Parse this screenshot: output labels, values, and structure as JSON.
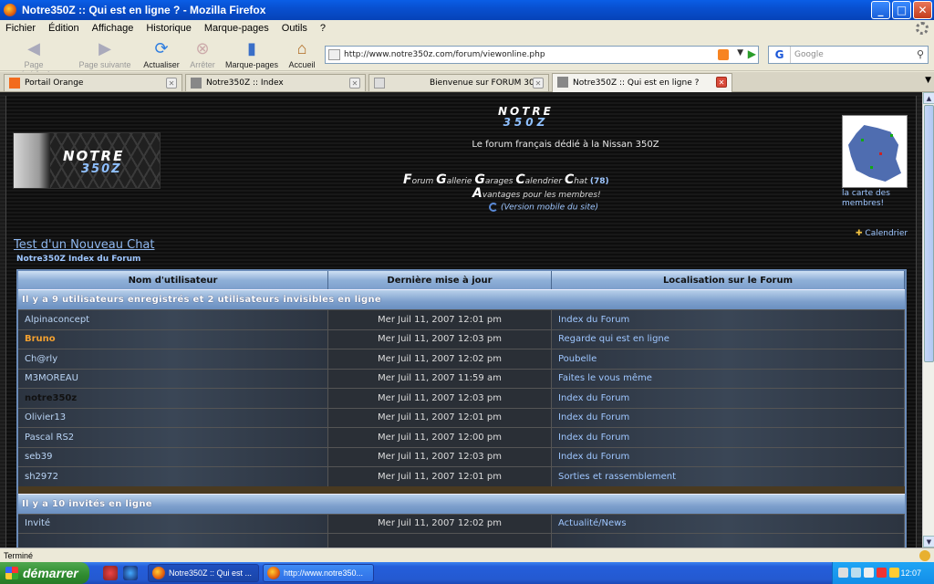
{
  "window": {
    "title": "Notre350Z :: Qui est en ligne ? - Mozilla Firefox",
    "buttons": [
      "_",
      "□",
      "✕"
    ]
  },
  "menu": [
    "Fichier",
    "Édition",
    "Affichage",
    "Historique",
    "Marque-pages",
    "Outils",
    "?"
  ],
  "toolbar": {
    "back": "Page précédente",
    "forward": "Page suivante",
    "reload": "Actualiser",
    "stop": "Arrêter",
    "bookmarks": "Marque-pages",
    "home": "Accueil",
    "url": "http://www.notre350z.com/forum/viewonline.php",
    "search_placeholder": "Google",
    "search_engine_icon": "G"
  },
  "tabs": [
    {
      "label": "Portail Orange",
      "icon_color": "#f26b1d"
    },
    {
      "label": "Notre350Z :: Index",
      "icon_color": "#888888"
    },
    {
      "label": "Bienvenue sur FORUM 30...",
      "icon_color": "#dddddd"
    },
    {
      "label": "Notre350Z :: Qui est en ligne ?",
      "icon_color": "#888888",
      "active": true
    }
  ],
  "page": {
    "logo_line1": "NOTRE",
    "logo_line2": "350Z",
    "tagline": "Le forum français dédié à la Nissan 350Z",
    "nav": {
      "forum": "orum",
      "galerie": "allerie",
      "garages": "arages",
      "calendrier": "alendrier",
      "chat": "hat",
      "chat_count": "(78)",
      "avantages": "vantages pour les membres!",
      "mobile": "(Version mobile du site)"
    },
    "map_caption": "la carte des membres!",
    "calendar_link": "Calendrier",
    "chat_title": "Test d'un Nouveau Chat",
    "breadcrumb": "Notre350Z Index du Forum",
    "table": {
      "headers": [
        "Nom d'utilisateur",
        "Dernière mise à jour",
        "Localisation sur le Forum"
      ],
      "registered_heading": "Il y a 9 utilisateurs enregistrés et 2 utilisateurs invisibles en ligne",
      "registered": [
        {
          "user": "Alpinaconcept",
          "time": "Mer Juil 11, 2007 12:01 pm",
          "location": "Index du Forum",
          "style": "normal"
        },
        {
          "user": "Bruno",
          "time": "Mer Juil 11, 2007 12:03 pm",
          "location": "Regarde qui est en ligne",
          "style": "orange"
        },
        {
          "user": "Ch@rly",
          "time": "Mer Juil 11, 2007 12:02 pm",
          "location": "Poubelle",
          "style": "normal"
        },
        {
          "user": "M3MOREAU",
          "time": "Mer Juil 11, 2007 11:59 am",
          "location": "Faites le vous même",
          "style": "normal"
        },
        {
          "user": "notre350z",
          "time": "Mer Juil 11, 2007 12:03 pm",
          "location": "Index du Forum",
          "style": "black"
        },
        {
          "user": "Olivier13",
          "time": "Mer Juil 11, 2007 12:01 pm",
          "location": "Index du Forum",
          "style": "normal"
        },
        {
          "user": "Pascal RS2",
          "time": "Mer Juil 11, 2007 12:00 pm",
          "location": "Index du Forum",
          "style": "normal"
        },
        {
          "user": "seb39",
          "time": "Mer Juil 11, 2007 12:03 pm",
          "location": "Index du Forum",
          "style": "normal"
        },
        {
          "user": "sh2972",
          "time": "Mer Juil 11, 2007 12:01 pm",
          "location": "Sorties et rassemblement",
          "style": "normal"
        }
      ],
      "guests_heading": "Il y a 10 invités en ligne",
      "guests": [
        {
          "user": "Invité",
          "time": "Mer Juil 11, 2007 12:02 pm",
          "location": "Actualité/News",
          "style": "normal"
        }
      ]
    }
  },
  "status": "Terminé",
  "taskbar": {
    "start": "démarrer",
    "items": [
      {
        "label": "Notre350Z :: Qui est ...",
        "active": true
      },
      {
        "label": "http://www.notre350..."
      }
    ],
    "clock": "12:07"
  }
}
